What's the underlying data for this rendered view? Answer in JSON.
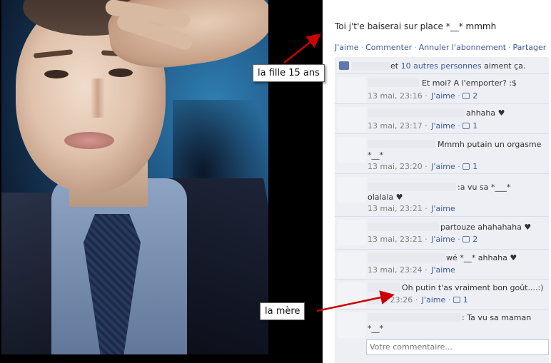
{
  "post": {
    "text": "Toi j't'e baiserai sur place *__* mmmh",
    "actions": [
      "J'aime",
      "Commenter",
      "Annuler l'abonnement",
      "Partager"
    ]
  },
  "likes": {
    "prefix": "et ",
    "link": "10 autres personnes",
    "suffix": " aiment ça."
  },
  "comments": [
    {
      "text": "Et moi? A l'emporter? :$",
      "time": "13 mai, 23:16",
      "like_label": "J'aime",
      "likes": "2"
    },
    {
      "text": "ahhaha ♥",
      "time": "13 mai, 23:17",
      "like_label": "J'aime",
      "likes": "1"
    },
    {
      "text": "Mmmh putain un orgasme",
      "text2": "*__*",
      "time": "13 mai, 23:20",
      "like_label": "J'aime",
      "likes": "1"
    },
    {
      "text": ":a vu sa *___*",
      "text2": "olalala ♥",
      "time": "13 mai, 23:21",
      "like_label": "J'aime",
      "likes": ""
    },
    {
      "text": "partouze ahahahaha ♥",
      "time": "13 mai, 23:21",
      "like_label": "J'aime",
      "likes": "2"
    },
    {
      "text": "wé *__* ahhaha ♥",
      "time": "13 mai, 23:24",
      "like_label": "J'aime",
      "likes": ""
    },
    {
      "text": "Oh putin t'as vraiment bon goût....:)",
      "time": "23:26",
      "like_label": "J'aime",
      "likes": "1"
    },
    {
      "text": ": Ta vu sa maman",
      "text2": "*__*",
      "time": "",
      "like_label": "",
      "likes": ""
    }
  ],
  "comment_box": {
    "placeholder": "Votre commentaire..."
  },
  "annotations": {
    "girl": "la fille 15 ans",
    "mother": "la mère"
  },
  "colors": {
    "link": "#3b5998",
    "ufi_bg": "#edeff4",
    "arrow": "#cc0000"
  }
}
